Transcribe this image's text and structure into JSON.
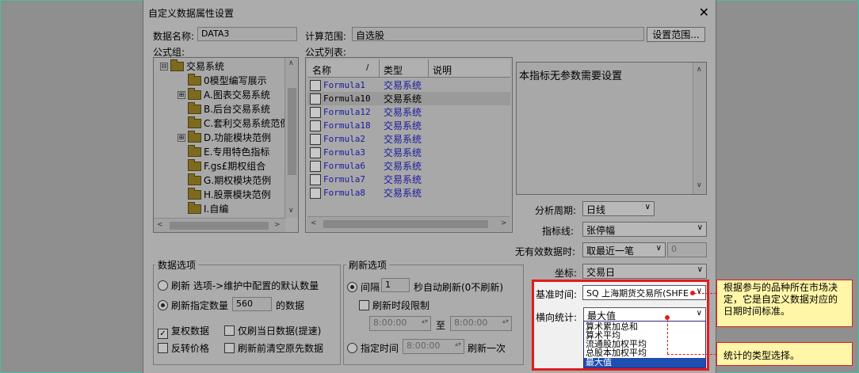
{
  "dialog": {
    "title": "自定义数据属性设置",
    "close_glyph": "✕"
  },
  "form": {
    "data_name_label": "数据名称:",
    "data_name_value": "DATA3",
    "calc_range_label": "计算范围:",
    "calc_range_value": "自选股",
    "set_range_button": "设置范围..."
  },
  "formula_group": {
    "label": "公式组:",
    "items": [
      {
        "label": "交易系统",
        "expander": "⊟",
        "level": 0
      },
      {
        "label": "0模型编写展示",
        "expander": "",
        "level": 1
      },
      {
        "label": "A.图表交易系统",
        "expander": "⊞",
        "level": 1
      },
      {
        "label": "B.后台交易系统",
        "expander": "",
        "level": 1
      },
      {
        "label": "C.套利交易系统范例",
        "expander": "",
        "level": 1
      },
      {
        "label": "D.功能模块范例",
        "expander": "⊞",
        "level": 1
      },
      {
        "label": "E.专用特色指标",
        "expander": "",
        "level": 1
      },
      {
        "label": "F.gs£期权组合",
        "expander": "",
        "level": 1
      },
      {
        "label": "G.期权模块范例",
        "expander": "",
        "level": 1
      },
      {
        "label": "H.股票模块范例",
        "expander": "",
        "level": 1
      },
      {
        "label": "I.自编",
        "expander": "",
        "level": 1
      }
    ]
  },
  "formula_list": {
    "label": "公式列表:",
    "columns": [
      "名称",
      "类型",
      "说明"
    ],
    "sort_glyph": "/",
    "rows": [
      {
        "name": "Formula1",
        "type": "交易系统"
      },
      {
        "name": "Formula10",
        "type": "交易系统"
      },
      {
        "name": "Formula12",
        "type": "交易系统"
      },
      {
        "name": "Formula18",
        "type": "交易系统"
      },
      {
        "name": "Formula2",
        "type": "交易系统"
      },
      {
        "name": "Formula3",
        "type": "交易系统"
      },
      {
        "name": "Formula6",
        "type": "交易系统"
      },
      {
        "name": "Formula7",
        "type": "交易系统"
      },
      {
        "name": "Formula8",
        "type": "交易系统"
      }
    ]
  },
  "param_panel": {
    "text": "本指标无参数需要设置"
  },
  "settings": {
    "period_label": "分析周期:",
    "period_value": "日线",
    "indicator_line_label": "指标线:",
    "indicator_line_value": "张停幅",
    "invalid_data_label": "无有效数据时:",
    "invalid_data_value": "取最近一笔",
    "invalid_data_num": "0",
    "axis_label": "坐标:",
    "axis_value": "交易日",
    "base_time_label": "基准时间:",
    "base_time_value": "SQ 上海期货交易所(SHFE",
    "cross_stat_label": "横向统计:",
    "cross_stat_value": "最大值",
    "cross_stat_options": [
      "算术累加总和",
      "算术平均",
      "流通股加权平均",
      "总股本加权平均",
      "最大值"
    ]
  },
  "data_options": {
    "title": "数据选项",
    "refresh_default_label": "刷新 选项->维护中配置的默认数量",
    "refresh_count_label": "刷新指定数量",
    "refresh_count_value": "560",
    "refresh_count_suffix": "的数据",
    "adj_label": "复权数据",
    "reverse_label": "反转价格",
    "today_only_label": "仅刷当日数据(提速)",
    "clear_label": "刷新前清空原先数据"
  },
  "refresh_options": {
    "title": "刷新选项",
    "interval_label": "间隔",
    "interval_value": "1",
    "interval_suffix": "秒自动刷新(0不刷新)",
    "period_limit_label": "刷新时段限制",
    "from_time": "8:00:00",
    "to_label": "至",
    "to_time": "8:00:00",
    "fixed_time_label": "指定时间",
    "fixed_time_value": "8:00:00",
    "fixed_time_suffix": "刷新一次"
  },
  "annotations": {
    "base_time_note": "根据参与的品种所在市场决定，它是自定义数据对应的日期时间标准。",
    "stat_note": "统计的类型选择。"
  },
  "colors": {
    "highlight": "#e21c1c",
    "callout_bg": "#fff6a8",
    "selection": "#1f4fb0"
  }
}
